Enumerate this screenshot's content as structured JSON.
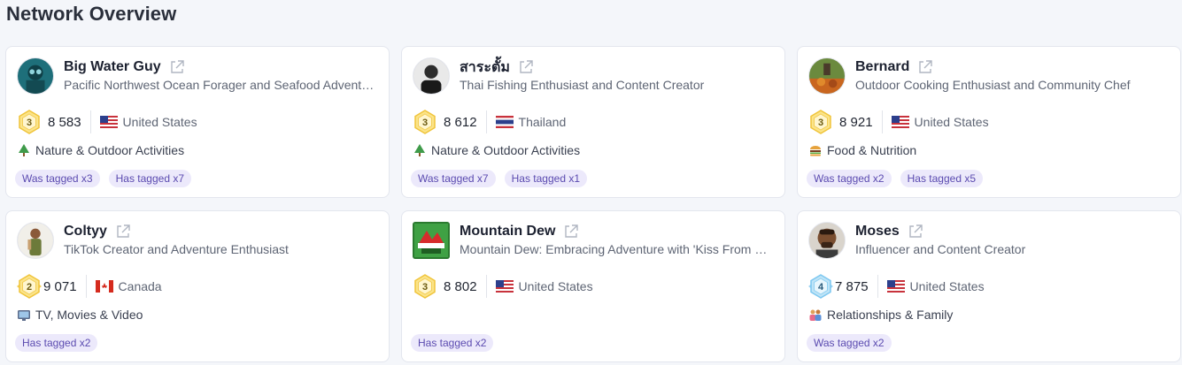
{
  "page_title": "Network Overview",
  "cards": [
    {
      "name": "Big Water Guy",
      "bio": "Pacific Northwest Ocean Forager and Seafood Adventurer",
      "rank": "3",
      "score": "8 583",
      "country": "United States",
      "category": "Nature & Outdoor Activities",
      "tags": [
        "Was tagged x3",
        "Has tagged x7"
      ]
    },
    {
      "name": "สาระตั้ม",
      "bio": "Thai Fishing Enthusiast and Content Creator",
      "rank": "3",
      "score": "8 612",
      "country": "Thailand",
      "category": "Nature & Outdoor Activities",
      "tags": [
        "Was tagged x7",
        "Has tagged x1"
      ]
    },
    {
      "name": "Bernard",
      "bio": "Outdoor Cooking Enthusiast and Community Chef",
      "rank": "3",
      "score": "8 921",
      "country": "United States",
      "category": "Food & Nutrition",
      "tags": [
        "Was tagged x2",
        "Has tagged x5"
      ]
    },
    {
      "name": "Coltyy",
      "bio": "TikTok Creator and Adventure Enthusiast",
      "rank": "2",
      "score": "9 071",
      "country": "Canada",
      "category": "TV, Movies & Video",
      "tags": [
        "Has tagged x2"
      ]
    },
    {
      "name": "Mountain Dew",
      "bio": "Mountain Dew: Embracing Adventure with 'Kiss From a Rose'",
      "rank": "3",
      "score": "8 802",
      "country": "United States",
      "category": "",
      "tags": [
        "Has tagged x2"
      ]
    },
    {
      "name": "Moses",
      "bio": "Influencer and Content Creator",
      "rank": "4",
      "score": "7 875",
      "country": "United States",
      "category": "Relationships & Family",
      "tags": [
        "Was tagged x2"
      ]
    }
  ],
  "colors": {
    "tag_bg": "#ece9fb",
    "tag_text": "#5b4bb0",
    "badge_gold": "#f3c94a",
    "badge_blue": "#7cc7f0"
  },
  "icons": {
    "external_link": "external-link-icon",
    "nature": "tree-icon",
    "food": "burger-icon",
    "tv": "tv-icon",
    "family": "people-icon"
  }
}
